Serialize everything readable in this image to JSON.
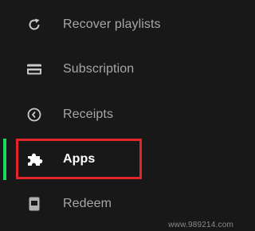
{
  "sidebar": {
    "items": [
      {
        "label": "Recover playlists",
        "icon": "refresh-icon"
      },
      {
        "label": "Subscription",
        "icon": "credit-card-icon"
      },
      {
        "label": "Receipts",
        "icon": "clock-icon"
      },
      {
        "label": "Apps",
        "icon": "puzzle-icon"
      },
      {
        "label": "Redeem",
        "icon": "gift-card-icon"
      }
    ],
    "active_item": "Apps"
  },
  "colors": {
    "background": "#181818",
    "text": "#a7a7a7",
    "active_text": "#ffffff",
    "active_indicator": "#1ed760",
    "highlight_box": "#e0262c"
  },
  "watermark": "www.989214.com"
}
